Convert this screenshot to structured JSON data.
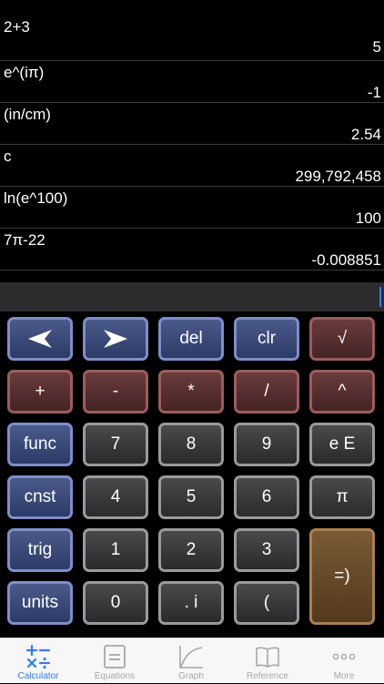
{
  "history": [
    {
      "expression": "2+3",
      "result": "5"
    },
    {
      "expression": "e^(iπ)",
      "result": "-1"
    },
    {
      "expression": "(in/cm)",
      "result": "2.54"
    },
    {
      "expression": "c",
      "result": "299,792,458"
    },
    {
      "expression": "ln(e^100)",
      "result": "100"
    },
    {
      "expression": "7π-22",
      "result": "-0.008851"
    }
  ],
  "keypad": {
    "del": "del",
    "clr": "clr",
    "sqrt": "√",
    "plus": "+",
    "minus": "-",
    "times": "*",
    "divide": "/",
    "power": "^",
    "func": "func",
    "seven": "7",
    "eight": "8",
    "nine": "9",
    "exp": "e E",
    "cnst": "cnst",
    "four": "4",
    "five": "5",
    "six": "6",
    "pi": "π",
    "trig": "trig",
    "one": "1",
    "two": "2",
    "three": "3",
    "equals": "=)",
    "units": "units",
    "zero": "0",
    "point_i": ". i",
    "paren": "("
  },
  "tabs": [
    {
      "label": "Calculator",
      "icon": "calculator-icon",
      "active": true
    },
    {
      "label": "Equations",
      "icon": "equations-icon"
    },
    {
      "label": "Graph",
      "icon": "graph-icon"
    },
    {
      "label": "Reference",
      "icon": "book-icon"
    },
    {
      "label": "More",
      "icon": "more-icon"
    }
  ],
  "colors": {
    "accent": "#2f7cf6",
    "blue_key": "#2c3a66",
    "red_key": "#452424",
    "gold_key": "#53391d",
    "gray_key": "#2a2a2c"
  }
}
